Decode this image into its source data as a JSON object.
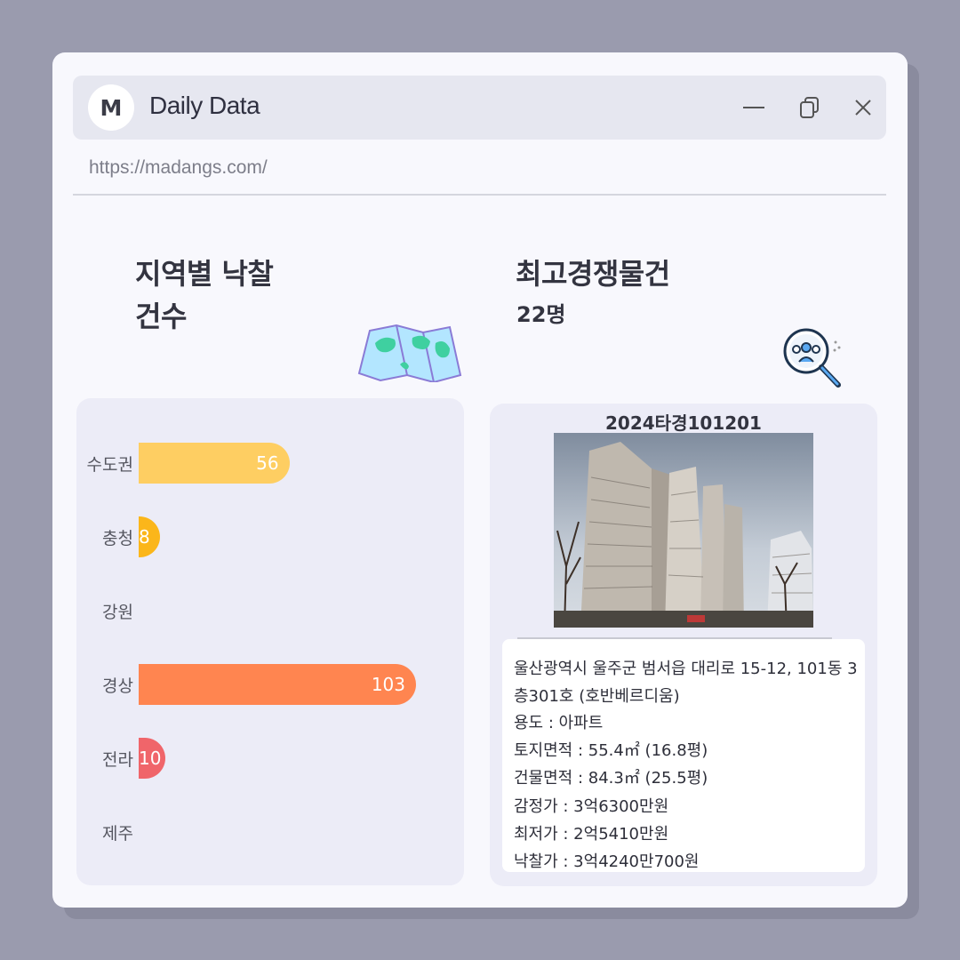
{
  "window": {
    "logo_letter": "M",
    "title": "Daily Data",
    "url": "https://madangs.com/",
    "controls": [
      "minimize",
      "restore",
      "close"
    ]
  },
  "left_panel": {
    "title_line1": "지역별 낙찰",
    "title_line2": "건수",
    "icon": "map-icon"
  },
  "right_panel": {
    "title": "최고경쟁물건",
    "subtitle": "22명",
    "icon": "people-search-icon"
  },
  "chart_data": {
    "type": "bar",
    "orientation": "horizontal",
    "categories": [
      "수도권",
      "충청",
      "강원",
      "경상",
      "전라",
      "제주"
    ],
    "values": [
      56,
      8,
      null,
      103,
      10,
      null
    ],
    "value_labels": [
      "56",
      "8",
      "",
      "103",
      "10",
      ""
    ],
    "colors": [
      "#fece62",
      "#fbb61a",
      "#cccccc",
      "#ff8550",
      "#f0656a",
      "#cccccc"
    ]
  },
  "property": {
    "case_no": "2024타경101201",
    "address_line1": "울산광역시 울주군 범서읍 대리로 15-12, 101동 3",
    "address_line2": "층301호 (호반베르디움)",
    "usage": "용도 : 아파트",
    "land_area": "토지면적 : 55.4㎡ (16.8평)",
    "building_area": "건물면적 : 84.3㎡ (25.5평)",
    "appraisal": "감정가 : 3억6300만원",
    "minimum": "최저가 : 2억5410만원",
    "winning_bid": "낙찰가 : 3억4240만700원"
  }
}
